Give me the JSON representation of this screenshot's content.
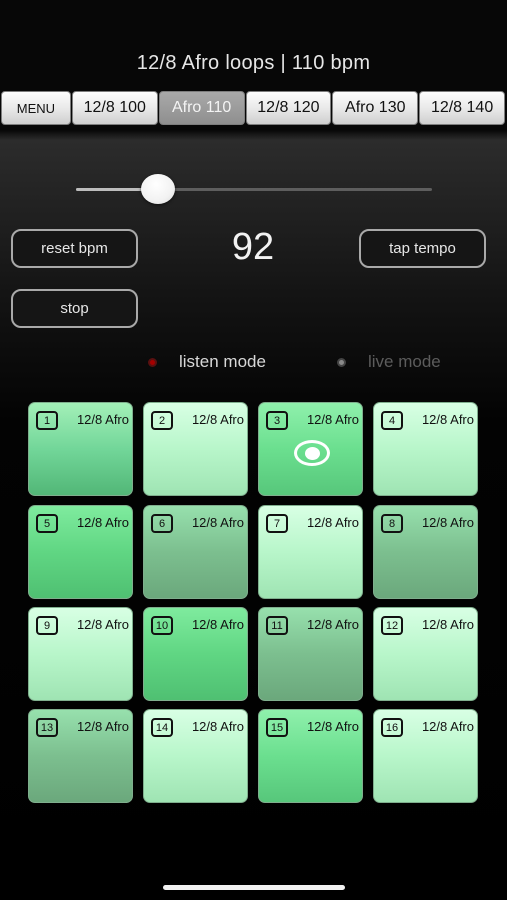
{
  "header": {
    "title": "12/8 Afro loops | 110 bpm"
  },
  "tabs": [
    {
      "label": "MENU",
      "active": false
    },
    {
      "label": "12/8 100",
      "active": false
    },
    {
      "label": "Afro 110",
      "active": true
    },
    {
      "label": "12/8 120",
      "active": false
    },
    {
      "label": "Afro 130",
      "active": false
    },
    {
      "label": "12/8 140",
      "active": false
    }
  ],
  "tempo": {
    "slider_level_percent": 23,
    "bpm_value": "92",
    "reset_label": "reset bpm",
    "tap_label": "tap tempo",
    "stop_label": "stop"
  },
  "modes": {
    "listen_label": "listen mode",
    "live_label": "live mode",
    "selected": "listen"
  },
  "pads": [
    {
      "number": "1",
      "label": "12/8 Afro",
      "playing": false
    },
    {
      "number": "2",
      "label": "12/8 Afro",
      "playing": false
    },
    {
      "number": "3",
      "label": "12/8 Afro",
      "playing": true
    },
    {
      "number": "4",
      "label": "12/8 Afro",
      "playing": false
    },
    {
      "number": "5",
      "label": "12/8 Afro",
      "playing": false
    },
    {
      "number": "6",
      "label": "12/8 Afro",
      "playing": false
    },
    {
      "number": "7",
      "label": "12/8 Afro",
      "playing": false
    },
    {
      "number": "8",
      "label": "12/8 Afro",
      "playing": false
    },
    {
      "number": "9",
      "label": "12/8 Afro",
      "playing": false
    },
    {
      "number": "10",
      "label": "12/8 Afro",
      "playing": false
    },
    {
      "number": "11",
      "label": "12/8 Afro",
      "playing": false
    },
    {
      "number": "12",
      "label": "12/8 Afro",
      "playing": false
    },
    {
      "number": "13",
      "label": "12/8 Afro",
      "playing": false
    },
    {
      "number": "14",
      "label": "12/8 Afro",
      "playing": false
    },
    {
      "number": "15",
      "label": "12/8 Afro",
      "playing": false
    },
    {
      "number": "16",
      "label": "12/8 Afro",
      "playing": false
    }
  ],
  "colors": {
    "active_tab": "#8f8f8f",
    "pad_green": "#72d699",
    "listen_radio": "#a50000"
  },
  "icons": {
    "playing": "play-indicator-icon",
    "listen_radio": "radio-selected-icon",
    "live_radio": "radio-unselected-icon"
  }
}
